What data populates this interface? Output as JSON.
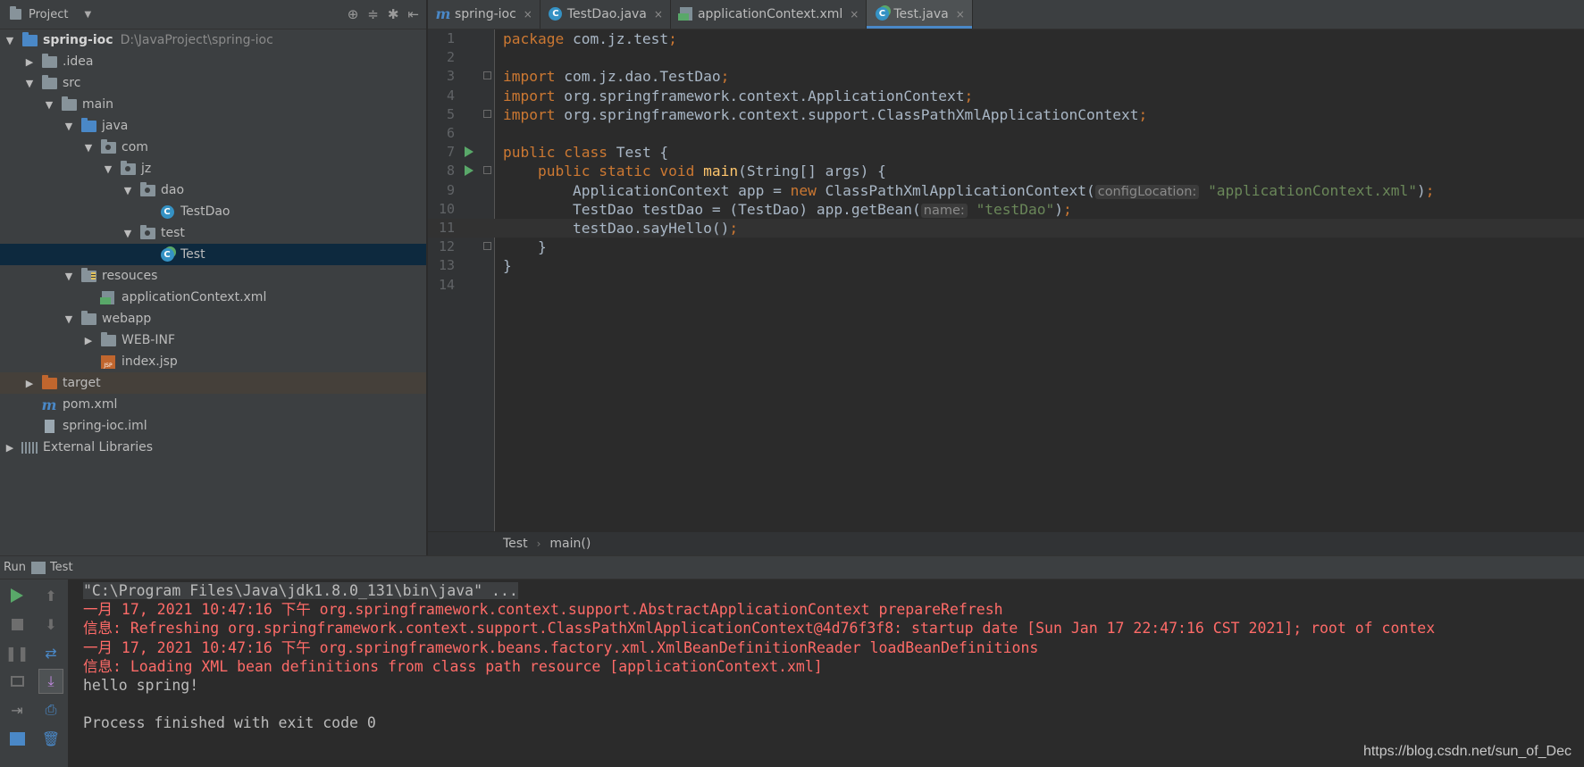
{
  "project_panel": {
    "title": "Project",
    "dropdown_icon": "▼",
    "tools": [
      "⊕",
      "≑",
      "✱",
      "⇤"
    ]
  },
  "tree": [
    {
      "label": "spring-ioc",
      "path": "D:\\JavaProject\\spring-ioc",
      "depth": 0,
      "arrow": "▼",
      "icon": "module-folder",
      "bold": true
    },
    {
      "label": ".idea",
      "depth": 1,
      "arrow": "▶",
      "icon": "folder"
    },
    {
      "label": "src",
      "depth": 1,
      "arrow": "▼",
      "icon": "folder"
    },
    {
      "label": "main",
      "depth": 2,
      "arrow": "▼",
      "icon": "folder"
    },
    {
      "label": "java",
      "depth": 3,
      "arrow": "▼",
      "icon": "source-folder"
    },
    {
      "label": "com",
      "depth": 4,
      "arrow": "▼",
      "icon": "package"
    },
    {
      "label": "jz",
      "depth": 5,
      "arrow": "▼",
      "icon": "package"
    },
    {
      "label": "dao",
      "depth": 6,
      "arrow": "▼",
      "icon": "package"
    },
    {
      "label": "TestDao",
      "depth": 7,
      "arrow": "",
      "icon": "class"
    },
    {
      "label": "test",
      "depth": 6,
      "arrow": "▼",
      "icon": "package"
    },
    {
      "label": "Test",
      "depth": 7,
      "arrow": "",
      "icon": "class-run",
      "selected": true
    },
    {
      "label": "resouces",
      "depth": 3,
      "arrow": "▼",
      "icon": "resources-folder"
    },
    {
      "label": "applicationContext.xml",
      "depth": 4,
      "arrow": "",
      "icon": "xml"
    },
    {
      "label": "webapp",
      "depth": 3,
      "arrow": "▼",
      "icon": "folder"
    },
    {
      "label": "WEB-INF",
      "depth": 4,
      "arrow": "▶",
      "icon": "folder"
    },
    {
      "label": "index.jsp",
      "depth": 4,
      "arrow": "",
      "icon": "jsp"
    },
    {
      "label": "target",
      "depth": 1,
      "arrow": "▶",
      "icon": "excluded-folder",
      "excluded": true
    },
    {
      "label": "pom.xml",
      "depth": 1,
      "arrow": "",
      "icon": "maven"
    },
    {
      "label": "spring-ioc.iml",
      "depth": 1,
      "arrow": "",
      "icon": "iml"
    },
    {
      "label": "External Libraries",
      "depth": 0,
      "arrow": "▶",
      "icon": "libraries"
    }
  ],
  "tabs": [
    {
      "label": "spring-ioc",
      "icon": "maven",
      "close": "×"
    },
    {
      "label": "TestDao.java",
      "icon": "class",
      "close": "×"
    },
    {
      "label": "applicationContext.xml",
      "icon": "xml",
      "close": "×"
    },
    {
      "label": "Test.java",
      "icon": "class-run",
      "close": "×",
      "active": true
    }
  ],
  "editor": {
    "current_line": 11,
    "lines": [
      {
        "n": "1",
        "tokens": [
          [
            "kw",
            "package "
          ],
          [
            "p",
            "com.jz.test"
          ],
          [
            "kw",
            ";"
          ]
        ]
      },
      {
        "n": "2",
        "tokens": []
      },
      {
        "n": "3",
        "fold": true,
        "tokens": [
          [
            "kw",
            "import "
          ],
          [
            "p",
            "com.jz.dao.TestDao"
          ],
          [
            "kw",
            ";"
          ]
        ]
      },
      {
        "n": "4",
        "tokens": [
          [
            "kw",
            "import "
          ],
          [
            "p",
            "org.springframework.context.ApplicationContext"
          ],
          [
            "kw",
            ";"
          ]
        ]
      },
      {
        "n": "5",
        "fold": true,
        "tokens": [
          [
            "kw",
            "import "
          ],
          [
            "p",
            "org.springframework.context.support.ClassPathXmlApplicationContext"
          ],
          [
            "kw",
            ";"
          ]
        ]
      },
      {
        "n": "6",
        "tokens": []
      },
      {
        "n": "7",
        "run": true,
        "tokens": [
          [
            "kw",
            "public class "
          ],
          [
            "p",
            "Test {"
          ]
        ]
      },
      {
        "n": "8",
        "run": true,
        "fold": true,
        "tokens": [
          [
            "p",
            "    "
          ],
          [
            "kw",
            "public static void "
          ],
          [
            "fn",
            "main"
          ],
          [
            "p",
            "(String[] args) {"
          ]
        ]
      },
      {
        "n": "9",
        "tokens": [
          [
            "p",
            "        ApplicationContext app = "
          ],
          [
            "kw",
            "new "
          ],
          [
            "p",
            "ClassPathXmlApplicationContext("
          ],
          [
            "hint",
            "configLocation:"
          ],
          [
            "str",
            "\"applicationContext.xml\""
          ],
          [
            "p",
            ")"
          ],
          [
            "kw",
            ";"
          ]
        ]
      },
      {
        "n": "10",
        "tokens": [
          [
            "p",
            "        TestDao testDao = (TestDao) app.getBean("
          ],
          [
            "hint",
            "name:"
          ],
          [
            "str",
            "\"testDao\""
          ],
          [
            "p",
            ")"
          ],
          [
            "kw",
            ";"
          ]
        ]
      },
      {
        "n": "11",
        "tokens": [
          [
            "p",
            "        testDao.sayHello()"
          ],
          [
            "kw",
            ";"
          ]
        ]
      },
      {
        "n": "12",
        "fold": true,
        "tokens": [
          [
            "p",
            "    }"
          ]
        ]
      },
      {
        "n": "13",
        "tokens": [
          [
            "p",
            "}"
          ]
        ]
      },
      {
        "n": "14",
        "tokens": []
      }
    ]
  },
  "breadcrumb": {
    "class": "Test",
    "separator": "›",
    "method": "main()"
  },
  "run_panel": {
    "label": "Run",
    "tab": "Test",
    "console": [
      {
        "type": "cmd",
        "text": "\"C:\\Program Files\\Java\\jdk1.8.0_131\\bin\\java\" ..."
      },
      {
        "type": "err",
        "text": "一月 17, 2021 10:47:16 下午 org.springframework.context.support.AbstractApplicationContext prepareRefresh"
      },
      {
        "type": "err",
        "text": "信息: Refreshing org.springframework.context.support.ClassPathXmlApplicationContext@4d76f3f8: startup date [Sun Jan 17 22:47:16 CST 2021]; root of contex"
      },
      {
        "type": "err",
        "text": "一月 17, 2021 10:47:16 下午 org.springframework.beans.factory.xml.XmlBeanDefinitionReader loadBeanDefinitions"
      },
      {
        "type": "err",
        "text": "信息: Loading XML bean definitions from class path resource [applicationContext.xml]"
      },
      {
        "type": "out",
        "text": "hello spring!"
      },
      {
        "type": "out",
        "text": ""
      },
      {
        "type": "out",
        "text": "Process finished with exit code 0"
      }
    ]
  },
  "watermark": "https://blog.csdn.net/sun_of_Dec",
  "colors": {
    "keyword": "#cc7832",
    "method": "#ffc66d",
    "string": "#6a8759",
    "error": "#ff6b68",
    "accent": "#4a88c7"
  }
}
